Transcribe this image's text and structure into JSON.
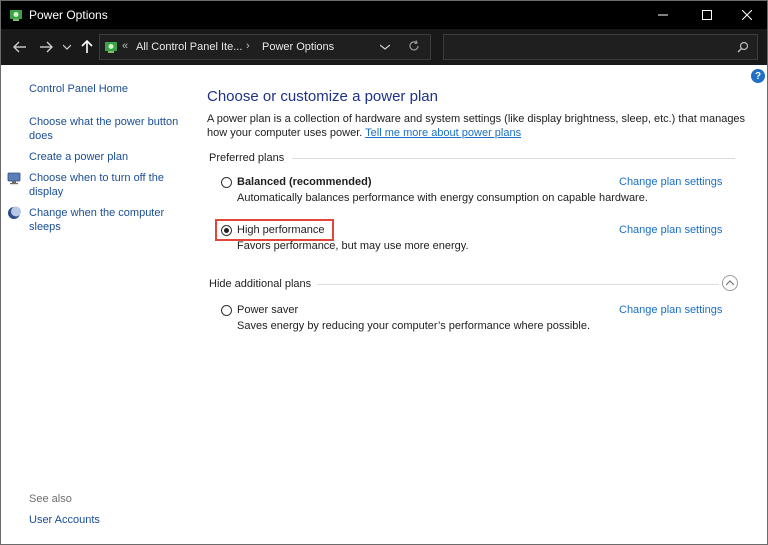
{
  "window": {
    "title": "Power Options",
    "icon": "power-options-icon",
    "buttons": {
      "minimize": "—",
      "maximize": "☐",
      "close": "✕"
    }
  },
  "nav": {
    "back_icon": "arrow-left-icon",
    "forward_icon": "arrow-right-icon",
    "recent_icon": "chevron-down-icon",
    "up_icon": "arrow-up-icon",
    "address": {
      "separator": "«",
      "crumb1": "All Control Panel Ite...",
      "arrow": "›",
      "crumb2": "Power Options"
    },
    "search_placeholder": ""
  },
  "sidebar": {
    "home": "Control Panel Home",
    "items": [
      {
        "label": "Choose what the power button does",
        "icon": ""
      },
      {
        "label": "Create a power plan",
        "icon": ""
      },
      {
        "label": "Choose when to turn off the display",
        "icon": "monitor-icon"
      },
      {
        "label": "Change when the computer sleeps",
        "icon": "moon-icon"
      }
    ],
    "see_also": "See also",
    "user_accounts": "User Accounts"
  },
  "main": {
    "title": "Choose or customize a power plan",
    "intro_text": "A power plan is a collection of hardware and system settings (like display brightness, sleep, etc.) that manages how your computer uses power.",
    "intro_link": "Tell me more about power plans",
    "preferred_label": "Preferred plans",
    "hide_label": "Hide additional plans",
    "plans": [
      {
        "name": "Balanced (recommended)",
        "desc": "Automatically balances performance with energy consumption on capable hardware.",
        "link": "Change plan settings",
        "selected": false
      },
      {
        "name": "High performance",
        "desc": "Favors performance, but may use more energy.",
        "link": "Change plan settings",
        "selected": true
      },
      {
        "name": "Power saver",
        "desc": "Saves energy by reducing your computer’s performance where possible.",
        "link": "Change plan settings",
        "selected": false
      }
    ]
  },
  "help": "?",
  "colors": {
    "link": "#1a4e95",
    "title": "#1e3287",
    "highlight": "#e2453a"
  }
}
